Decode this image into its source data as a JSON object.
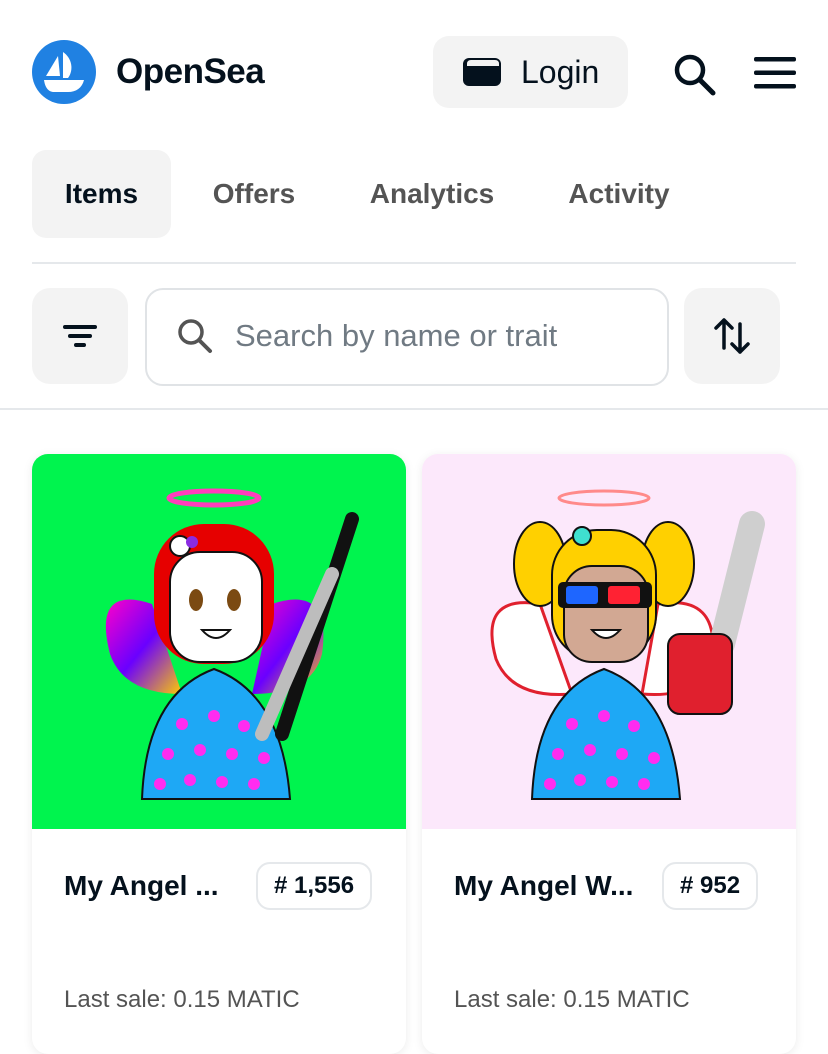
{
  "brand": {
    "name": "OpenSea",
    "color": "#2081e2"
  },
  "header": {
    "login_label": "Login"
  },
  "tabs": [
    {
      "label": "Items",
      "active": true
    },
    {
      "label": "Offers",
      "active": false
    },
    {
      "label": "Analytics",
      "active": false
    },
    {
      "label": "Activity",
      "active": false
    }
  ],
  "search": {
    "placeholder": "Search by name or trait",
    "value": ""
  },
  "icons": {
    "filter": "filter-icon",
    "search": "search-icon",
    "sort": "sort-icon",
    "menu": "menu-icon",
    "wallet": "wallet-icon"
  },
  "items": [
    {
      "name": "My Angel ...",
      "token": "# 1,556",
      "last_sale": "Last sale: 0.15 MATIC",
      "bg_color": "#00f44e"
    },
    {
      "name": "My Angel W...",
      "token": "# 952",
      "last_sale": "Last sale: 0.15 MATIC",
      "bg_color": "#fce8fb"
    }
  ]
}
